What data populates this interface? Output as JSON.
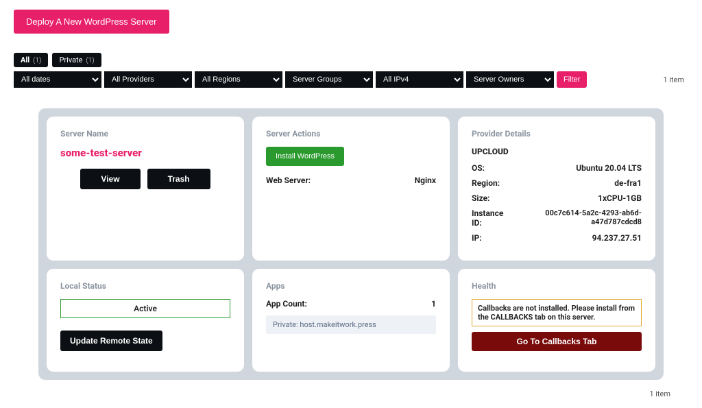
{
  "header": {
    "deploy_label": "Deploy A New WordPress Server"
  },
  "tabs": {
    "all_label": "All",
    "all_count": "(1)",
    "private_label": "Private",
    "private_count": "(1)"
  },
  "filters": {
    "dates": "All dates",
    "providers": "All Providers",
    "regions": "All Regions",
    "groups": "Server Groups",
    "ipv4": "All IPv4",
    "owners": "Server Owners",
    "filter_label": "Filter",
    "count_label": "1 item"
  },
  "cards": {
    "server_name": {
      "heading": "Server Name",
      "title": "some-test-server",
      "view_label": "View",
      "trash_label": "Trash"
    },
    "server_actions": {
      "heading": "Server Actions",
      "install_label": "Install WordPress",
      "web_server_label": "Web Server:",
      "web_server_value": "Nginx"
    },
    "provider": {
      "heading": "Provider Details",
      "name": "UPCLOUD",
      "rows": {
        "os_l": "OS:",
        "os_v": "Ubuntu 20.04 LTS",
        "region_l": "Region:",
        "region_v": "de-fra1",
        "size_l": "Size:",
        "size_v": "1xCPU-1GB",
        "inst_l": "Instance ID:",
        "inst_v": "00c7c614-5a2c-4293-ab6d-a47d787cdcd8",
        "ip_l": "IP:",
        "ip_v": "94.237.27.51"
      }
    },
    "local_status": {
      "heading": "Local Status",
      "status": "Active",
      "update_label": "Update Remote State"
    },
    "apps": {
      "heading": "Apps",
      "count_l": "App Count:",
      "count_v": "1",
      "row": "Private: host.makeitwork.press"
    },
    "health": {
      "heading": "Health",
      "warn": "Callbacks are not installed. Please install from the CALLBACKS tab on this server.",
      "btn": "Go To Callbacks Tab"
    }
  },
  "footer": {
    "count_label": "1 item"
  }
}
